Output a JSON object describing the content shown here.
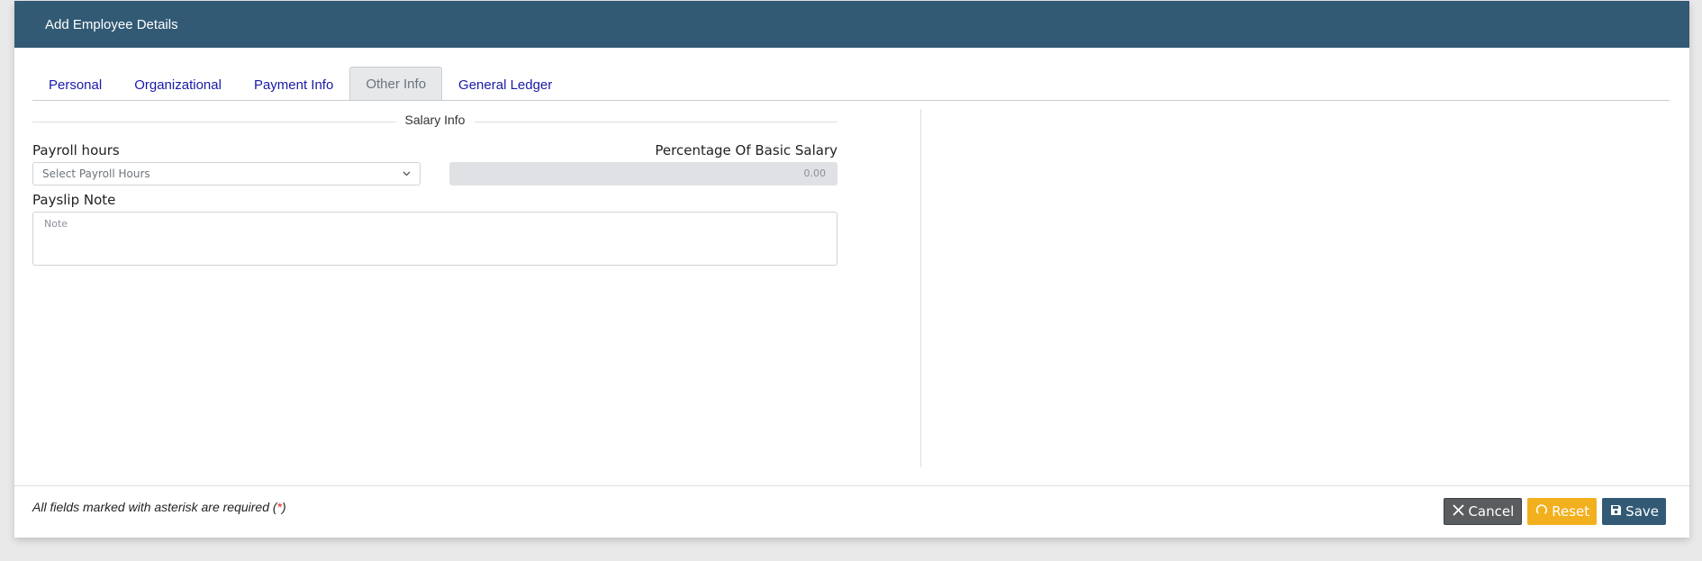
{
  "modal": {
    "title": "Add Employee Details"
  },
  "tabs": [
    {
      "label": "Personal"
    },
    {
      "label": "Organizational"
    },
    {
      "label": "Payment Info"
    },
    {
      "label": "Other Info",
      "active": true
    },
    {
      "label": "General Ledger"
    }
  ],
  "salary_info": {
    "section_title": "Salary Info",
    "payroll_hours": {
      "label": "Payroll hours",
      "placeholder": "Select Payroll Hours"
    },
    "percentage": {
      "label": "Percentage Of Basic Salary",
      "value": "0.00"
    },
    "payslip_note": {
      "label": "Payslip Note",
      "placeholder": "Note"
    }
  },
  "footer": {
    "required_text": "All fields marked with asterisk are required (",
    "required_star": "*",
    "required_close": ")",
    "cancel_label": "Cancel",
    "reset_label": "Reset",
    "save_label": "Save"
  },
  "icons": {
    "cancel": "close-icon",
    "reset": "refresh-icon",
    "save": "save-icon",
    "dropdown": "chevron-down-icon"
  },
  "colors": {
    "header": "#325a75",
    "tab_link": "#1a1aa8",
    "cancel": "#5a5d60",
    "reset": "#f2b01e",
    "save": "#325a75",
    "asterisk": "#d9261c"
  }
}
